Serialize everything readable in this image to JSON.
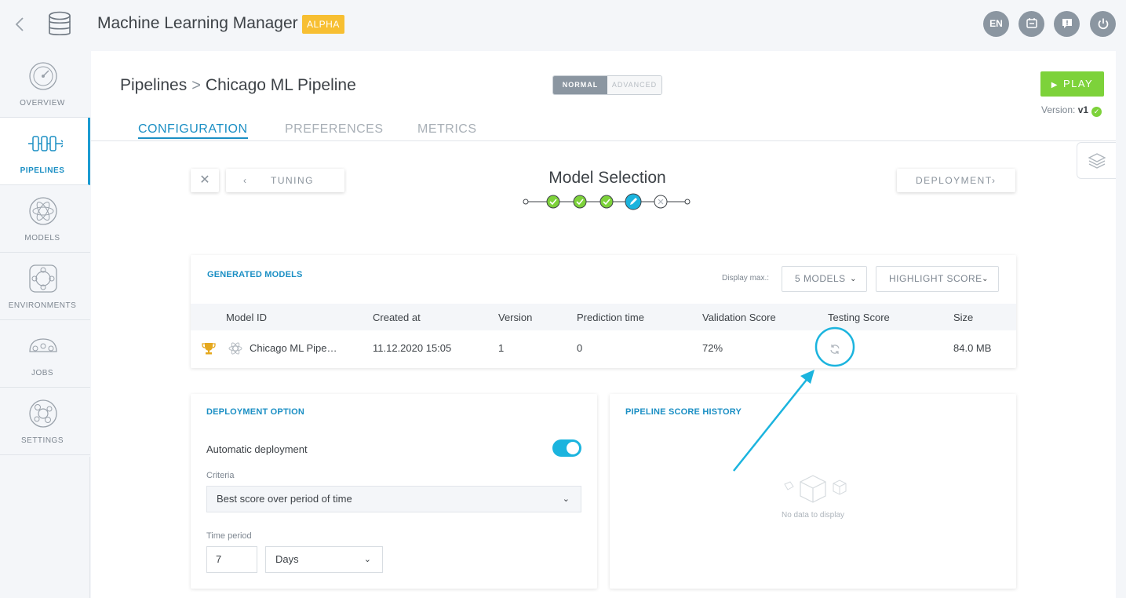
{
  "app": {
    "title": "Machine Learning Manager",
    "badge": "ALPHA",
    "lang": "EN"
  },
  "sidebar": {
    "items": [
      {
        "label": "OVERVIEW",
        "icon": "overview-gauge-icon"
      },
      {
        "label": "PIPELINES",
        "icon": "pipelines-icon",
        "active": true
      },
      {
        "label": "MODELS",
        "icon": "models-icon"
      },
      {
        "label": "ENVIRONMENTS",
        "icon": "environments-icon"
      },
      {
        "label": "JOBS",
        "icon": "jobs-icon"
      },
      {
        "label": "SETTINGS",
        "icon": "settings-gear-icon"
      }
    ]
  },
  "header": {
    "breadcrumb_root": "Pipelines",
    "breadcrumb_current": "Chicago ML Pipeline",
    "mode_normal": "NORMAL",
    "mode_advanced": "ADVANCED",
    "play_label": "PLAY",
    "version_label": "Version:",
    "version_value": "v1"
  },
  "tabs": [
    {
      "label": "CONFIGURATION",
      "active": true
    },
    {
      "label": "PREFERENCES"
    },
    {
      "label": "METRICS"
    }
  ],
  "wizard": {
    "prev_label": "TUNING",
    "next_label": "DEPLOYMENT",
    "step_title": "Model Selection",
    "steps": [
      "done",
      "done",
      "done",
      "current",
      "todo"
    ]
  },
  "models": {
    "title": "GENERATED MODELS",
    "display_max_label": "Display max.:",
    "display_max_value": "5 MODELS",
    "highlight_label": "HIGHLIGHT SCORE",
    "columns": [
      "Model ID",
      "Created at",
      "Version",
      "Prediction time",
      "Validation Score",
      "Testing Score",
      "Size"
    ],
    "rows": [
      {
        "model_id": "Chicago ML Pipe…",
        "created_at": "11.12.2020 15:05",
        "version": "1",
        "prediction_time": "0",
        "validation_score": "72%",
        "testing_score_status": "loading",
        "size": "84.0 MB"
      }
    ]
  },
  "deployment": {
    "title": "DEPLOYMENT OPTION",
    "auto_label": "Automatic deployment",
    "auto_enabled": true,
    "criteria_label": "Criteria",
    "criteria_value": "Best score over period of time",
    "period_label": "Time period",
    "period_value": "7",
    "period_unit": "Days"
  },
  "history": {
    "title": "PIPELINE SCORE HISTORY",
    "empty_text": "No data to display"
  },
  "colors": {
    "accent": "#1b8fc4",
    "highlight": "#1bb4de",
    "success": "#7dd23a",
    "badge": "#f7bf32"
  }
}
